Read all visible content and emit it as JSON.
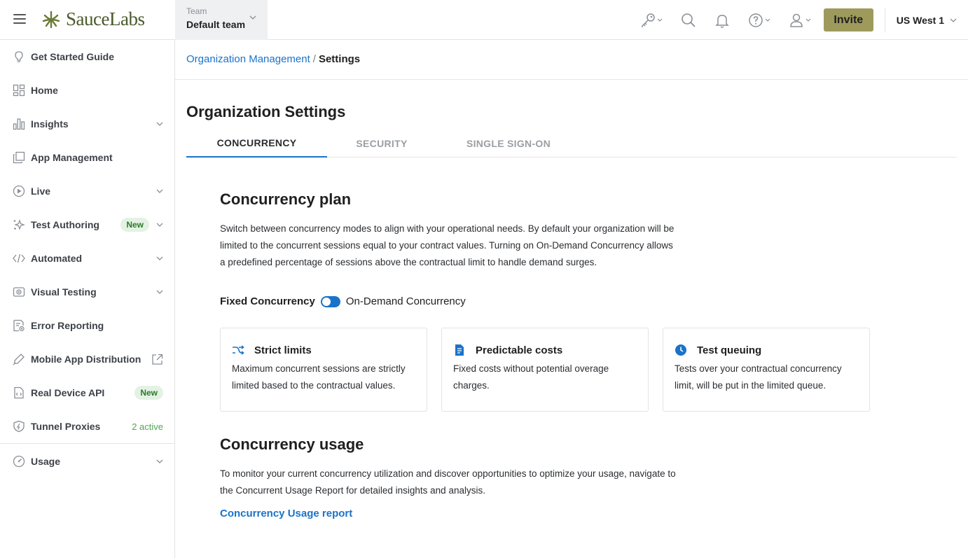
{
  "header": {
    "brand": "SauceLabs",
    "team_label": "Team",
    "team_value": "Default team",
    "invite_label": "Invite",
    "region": "US West 1",
    "icons": [
      "key-icon",
      "search-icon",
      "bell-icon",
      "help-icon",
      "user-icon"
    ]
  },
  "sidebar": {
    "items": [
      {
        "label": "Get Started Guide",
        "icon": "lightbulb-icon"
      },
      {
        "label": "Home",
        "icon": "grid-icon"
      },
      {
        "label": "Insights",
        "icon": "bar-chart-icon"
      },
      {
        "label": "App Management",
        "icon": "copy-icon"
      },
      {
        "label": "Live",
        "icon": "play-circle-icon"
      },
      {
        "label": "Test Authoring",
        "icon": "sparkle-icon",
        "badge": "New"
      },
      {
        "label": "Automated",
        "icon": "code-icon"
      },
      {
        "label": "Visual Testing",
        "icon": "eye-icon"
      },
      {
        "label": "Error Reporting",
        "icon": "document-error-icon"
      },
      {
        "label": "Mobile App Distribution",
        "icon": "pen-icon"
      },
      {
        "label": "Real Device API",
        "icon": "file-code-icon",
        "badge": "New"
      },
      {
        "label": "Tunnel Proxies",
        "icon": "shield-icon",
        "status": "2 active"
      },
      {
        "label": "Usage",
        "icon": "gauge-icon"
      }
    ]
  },
  "breadcrumb": {
    "parent": "Organization Management",
    "separator": "/",
    "current": "Settings"
  },
  "page": {
    "title": "Organization Settings",
    "tabs": [
      "CONCURRENCY",
      "SECURITY",
      "SINGLE SIGN-ON"
    ],
    "active_tab": "CONCURRENCY"
  },
  "plan": {
    "heading": "Concurrency plan",
    "lines": [
      "Switch between concurrency modes to align with your operational needs. By default your organization will be",
      "limited to the concurrent sessions equal to your contract values. Turning on On-Demand Concurrency allows",
      "a predefined percentage of sessions above the contractual limit to handle demand surges."
    ],
    "toggle_left": "Fixed Concurrency",
    "toggle_right": "On-Demand Concurrency",
    "cards": [
      {
        "title": "Strict limits",
        "icon": "shuffle-icon",
        "lines": [
          "Maximum concurrent sessions are strictly",
          "limited based to the contractual values."
        ]
      },
      {
        "title": "Predictable costs",
        "icon": "invoice-icon",
        "lines": [
          "Fixed costs without potential overage",
          "charges."
        ]
      },
      {
        "title": "Test queuing",
        "icon": "clock-icon",
        "lines": [
          "Tests over your contractual concurrency",
          "limit, will be put in the limited queue."
        ]
      }
    ]
  },
  "usage": {
    "heading": "Concurrency usage",
    "lines": [
      "To monitor your current concurrency utilization and discover opportunities to optimize your usage, navigate to",
      "the Concurrent Usage Report for detailed insights and analysis."
    ],
    "link": "Concurrency Usage report"
  },
  "colors": {
    "accent": "#1a73c9",
    "invite": "#9e9a5c",
    "brand": "#4a5a2c",
    "badge_bg": "#e3f2e3",
    "badge_text": "#2b7a2b",
    "active_status": "#4fa94f"
  }
}
